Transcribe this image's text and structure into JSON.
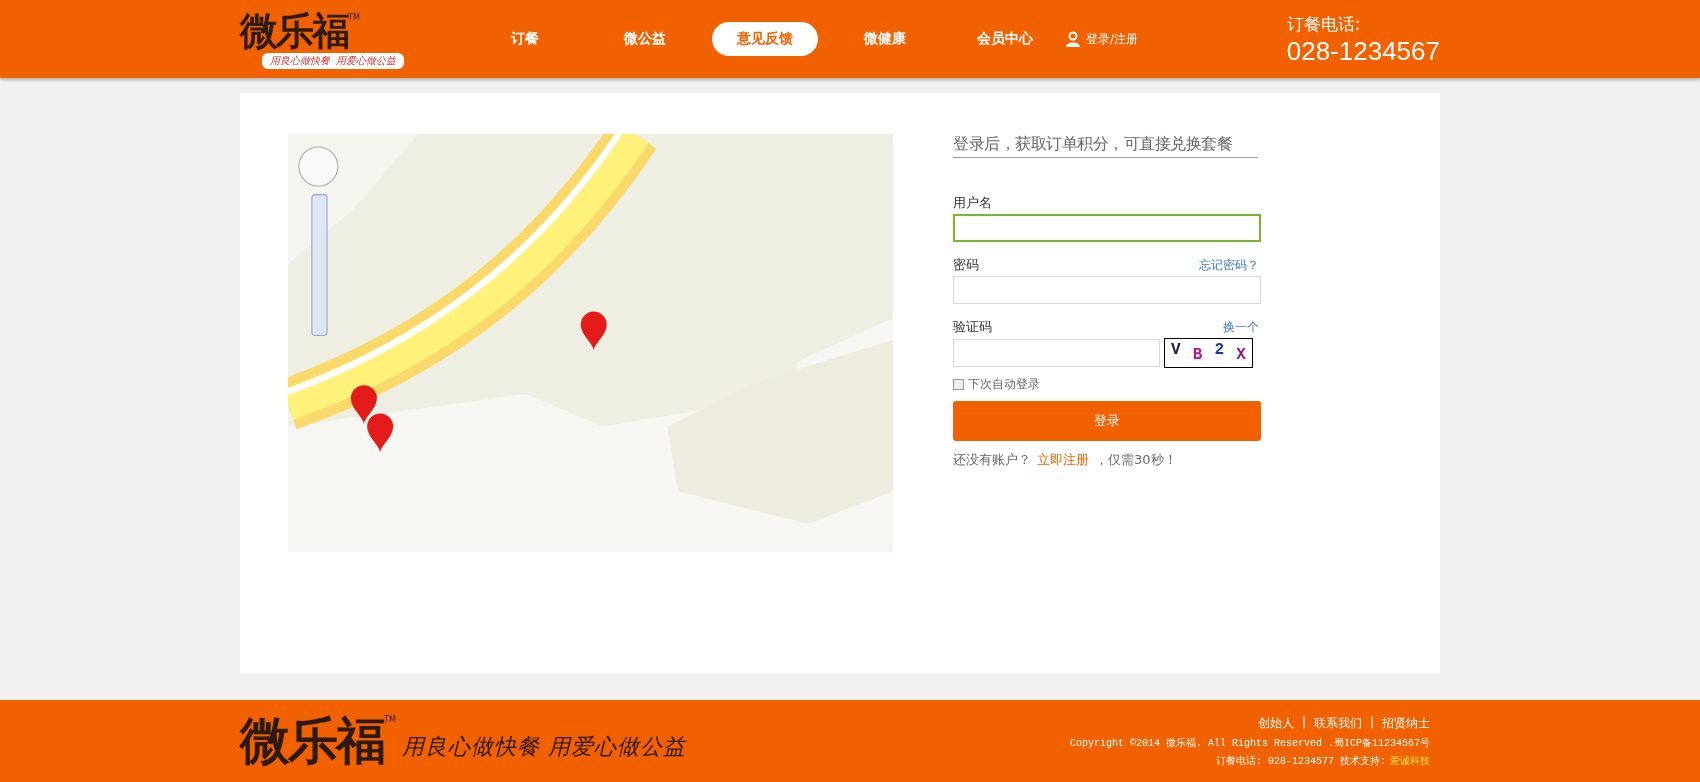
{
  "header": {
    "logo": {
      "name": "微乐福",
      "tm": "TM",
      "slogan": "用良心做快餐  用爱心做公益"
    },
    "nav": [
      {
        "label": "订餐",
        "selected": false
      },
      {
        "label": "微公益",
        "selected": false
      },
      {
        "label": "意见反馈",
        "selected": true
      },
      {
        "label": "微健康",
        "selected": false
      },
      {
        "label": "会员中心",
        "selected": false
      }
    ],
    "login_link": "登录/注册",
    "phone": {
      "label": "订餐电话:",
      "number": "028-1234567"
    }
  },
  "login_form": {
    "title": "登录后，获取订单积分，可直接兑换套餐",
    "username": {
      "label": "用户名",
      "focused": true
    },
    "password": {
      "label": "密码",
      "focused": false,
      "forgot_link": "忘记密码？"
    },
    "captcha": {
      "label": "验证码",
      "focused": false,
      "refresh_link": "换一个",
      "chars": [
        {
          "char": "V",
          "color": "#222244"
        },
        {
          "char": "B",
          "color": "#b0189a"
        },
        {
          "char": "2",
          "color": "#1a3a9a"
        },
        {
          "char": "X",
          "color": "#8a1a8a"
        }
      ]
    },
    "remember": {
      "label": "下次自动登录",
      "checked": false
    },
    "submit": "登录",
    "register": {
      "before": "还没有账户？",
      "link": "立即注册",
      "after": "，仅需30秒！"
    }
  },
  "footer": {
    "logo": {
      "name": "微乐福",
      "tm": "TM",
      "slogan": "用良心做快餐 用爱心做公益"
    },
    "links": [
      "创始人",
      "联系我们",
      "招贤纳士"
    ],
    "separator": "|",
    "copyright": "Copyright ©2014 微乐福. All Rights Reserved .蜀ICP备11234567号",
    "contact": {
      "text": "订餐电话: 028-1234577 技术支持:",
      "link": "爱诚科技"
    }
  }
}
